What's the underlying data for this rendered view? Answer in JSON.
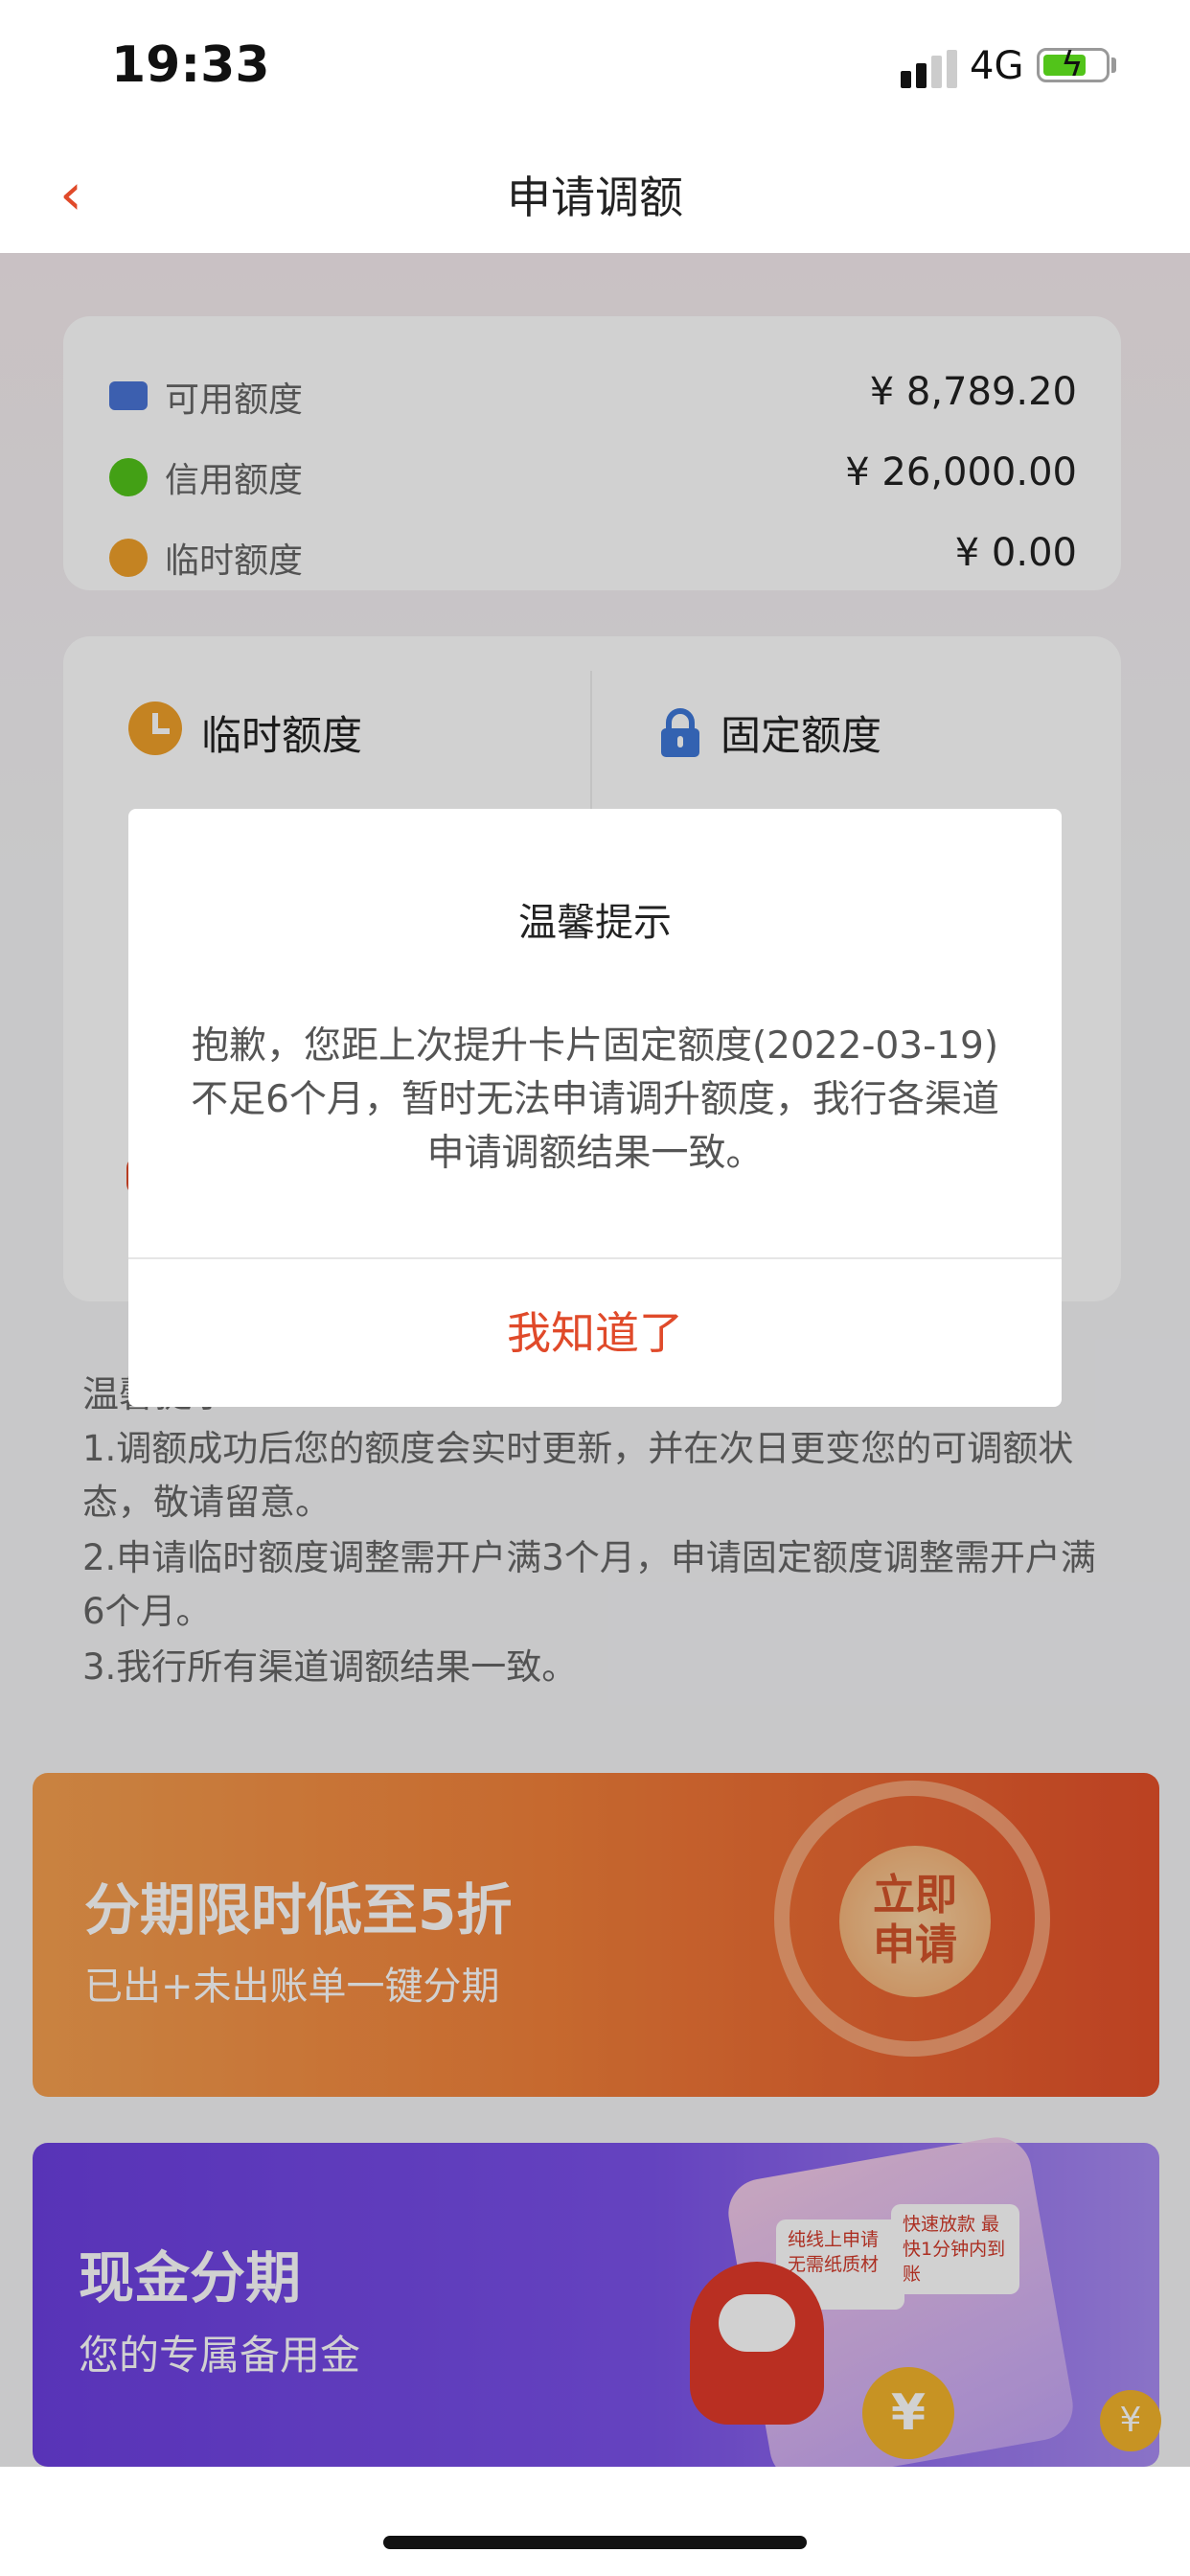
{
  "status_bar": {
    "time": "19:33",
    "network": "4G",
    "battery_color": "#52c41a"
  },
  "nav": {
    "back_icon": "chevron-left-icon",
    "title": "申请调额"
  },
  "summary": {
    "rows": [
      {
        "icon": "card-icon",
        "label": "可用额度",
        "value": "¥ 8,789.20",
        "icon_color": "#4a74d6"
      },
      {
        "icon": "pie-icon",
        "label": "信用额度",
        "value": "¥ 26,000.00",
        "icon_color": "#52c41a"
      },
      {
        "icon": "clock-icon",
        "label": "临时额度",
        "value": "¥ 0.00",
        "icon_color": "#f0a02a"
      }
    ]
  },
  "tabs": [
    {
      "icon": "clock-icon",
      "label": "临时额度"
    },
    {
      "icon": "lock-icon",
      "label": "固定额度"
    }
  ],
  "tips": {
    "title": "温馨提示",
    "items": [
      "1.调额成功后您的额度会实时更新，并在次日更变您的可调额状态，敬请留意。",
      "2.申请临时额度调整需开户满3个月，申请固定额度调整需开户满6个月。",
      "3.我行所有渠道调额结果一致。"
    ]
  },
  "banner1": {
    "title": "分期限时低至5折",
    "subtitle": "已出+未出账单一键分期",
    "button": "立即申请"
  },
  "banner2": {
    "title": "现金分期",
    "subtitle": "您的专属备用金",
    "tags": [
      "纯线上申请 无需纸质材料",
      "快速放款 最快1分钟内到账"
    ],
    "coin_symbol": "¥"
  },
  "modal": {
    "title": "温馨提示",
    "body": "抱歉，您距上次提升卡片固定额度(2022-03-19)不足6个月，暂时无法申请调升额度，我行各渠道申请调额结果一致。",
    "ok_label": "我知道了",
    "accent": "#e04a2a"
  }
}
